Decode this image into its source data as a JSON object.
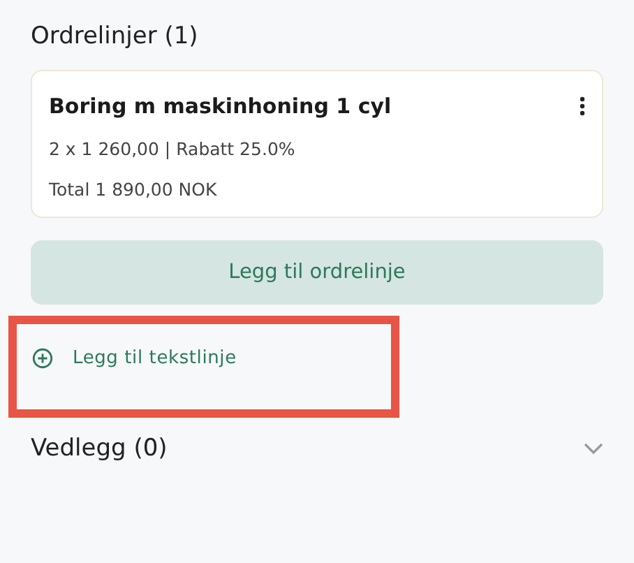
{
  "order_lines": {
    "title": "Ordrelinjer (1)",
    "items": [
      {
        "name": "Boring m maskinhoning 1 cyl",
        "details": "2 x 1 260,00 | Rabatt 25.0%",
        "total": "Total 1 890,00 NOK"
      }
    ],
    "add_button": "Legg til ordrelinje",
    "add_text_line": {
      "label": "Legg til tekstlinje",
      "highlighted": true
    }
  },
  "attachments": {
    "title": "Vedlegg (0)",
    "expanded": false
  }
}
